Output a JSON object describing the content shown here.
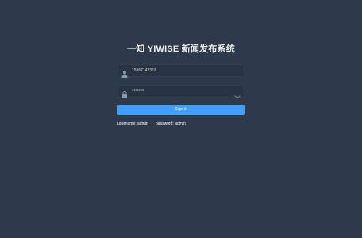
{
  "login": {
    "title": "一知 YIWISE 新闻发布系统",
    "username_value": "15967142353",
    "password_value": "•••••••",
    "signin_label": "Sign in",
    "tip_username": "username: admin",
    "tip_password": "password: admin"
  },
  "icons": {
    "user": "user-icon",
    "lock": "lock-icon",
    "eye": "eye-icon"
  },
  "colors": {
    "background": "#2d3a4b",
    "input_bg": "#283443",
    "button": "#409eff"
  }
}
